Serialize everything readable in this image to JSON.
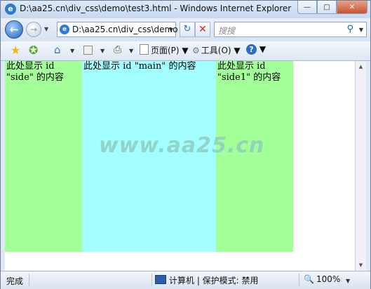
{
  "window": {
    "title": "D:\\aa25.cn\\div_css\\demo\\test3.html - Windows Internet Explorer",
    "title_icon": "ie-logo-icon",
    "buttons": [
      "minimize",
      "maximize",
      "close"
    ]
  },
  "nav": {
    "address": "D:\\aa25.cn\\div_css\\demo",
    "search_placeholder": "搜搜",
    "back_icon": "back-arrow-icon",
    "forward_icon": "forward-arrow-icon",
    "refresh_icon": "refresh-icon",
    "stop_icon": "stop-icon"
  },
  "commandbar": {
    "page_label": "页面(P)",
    "tools_label": "工具(O)",
    "icons": [
      "favorites-star-icon",
      "add-favorite-icon",
      "home-icon",
      "feeds-icon",
      "print-icon",
      "page-icon",
      "gear-icon",
      "help-icon"
    ]
  },
  "content": {
    "side": "此处显示  id \"side\" 的内容",
    "main": "此处显示  id \"main\" 的内容",
    "side1": "此处显示  id \"side1\" 的内容",
    "watermark": "www.aa25.cn",
    "colors": {
      "side": "#a3ff98",
      "main": "#a3ffff",
      "side1": "#a3ff98"
    }
  },
  "status": {
    "text": "完成",
    "zone": "计算机 | 保护模式: 禁用",
    "zoom": "100%"
  }
}
